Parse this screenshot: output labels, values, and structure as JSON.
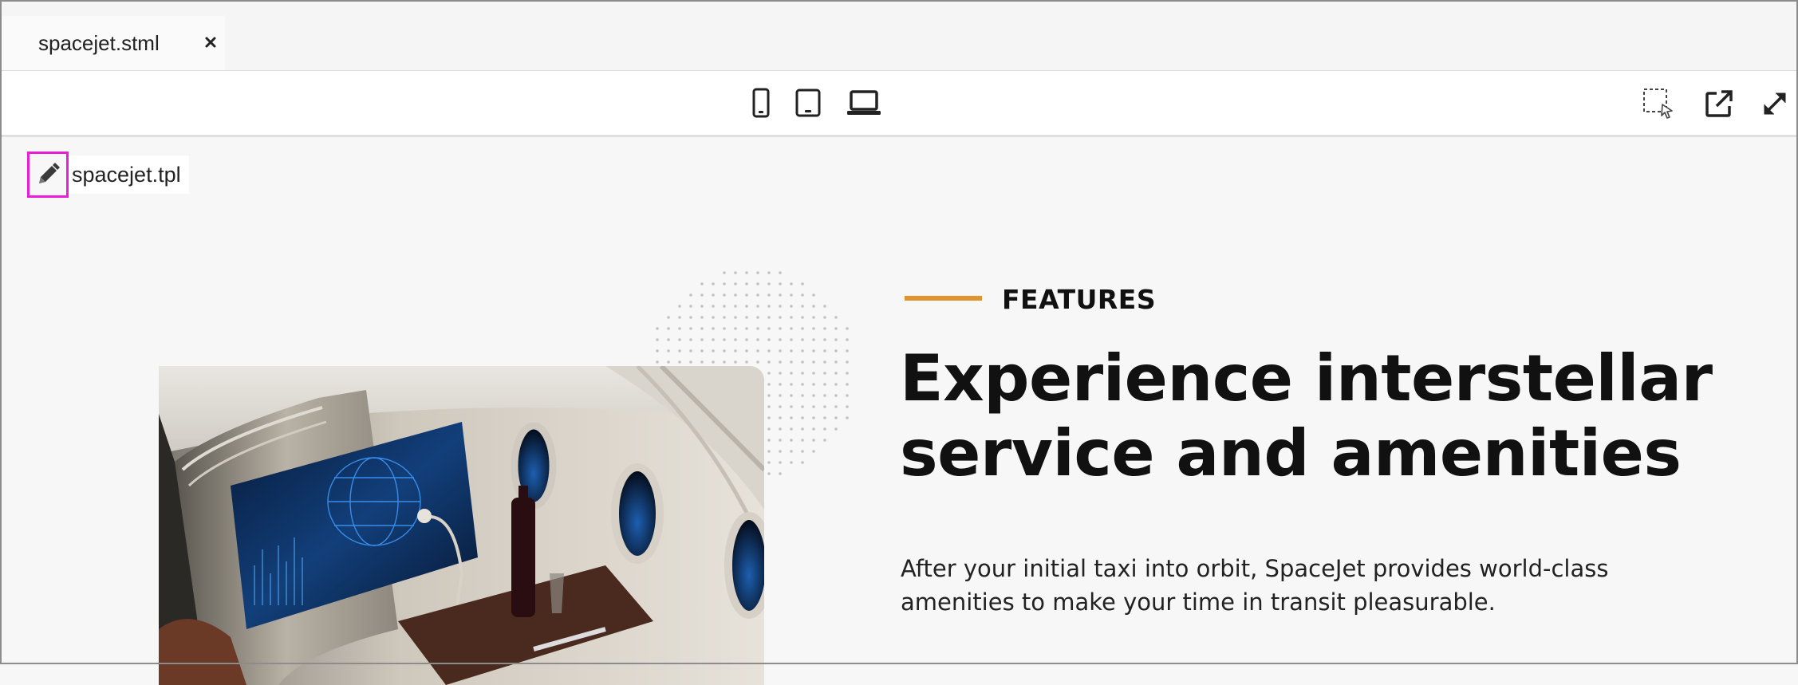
{
  "tabs": [
    {
      "label": "spacejet.stml",
      "active": true
    }
  ],
  "toolbar": {
    "device_buttons": [
      "phone-icon",
      "tablet-icon",
      "laptop-icon"
    ],
    "right_buttons": [
      "select-element-icon",
      "open-external-icon",
      "expand-icon"
    ]
  },
  "preview": {
    "template_label": "spacejet.tpl",
    "section_label": "FEATURES",
    "headline_line1": "Experience interstellar",
    "headline_line2": "service and amenities",
    "body": "After your initial taxi into orbit, SpaceJet provides world-class amenities to make your time in transit pleasurable.",
    "accent_color": "#e0932e",
    "highlight_color": "#e91ed6"
  }
}
